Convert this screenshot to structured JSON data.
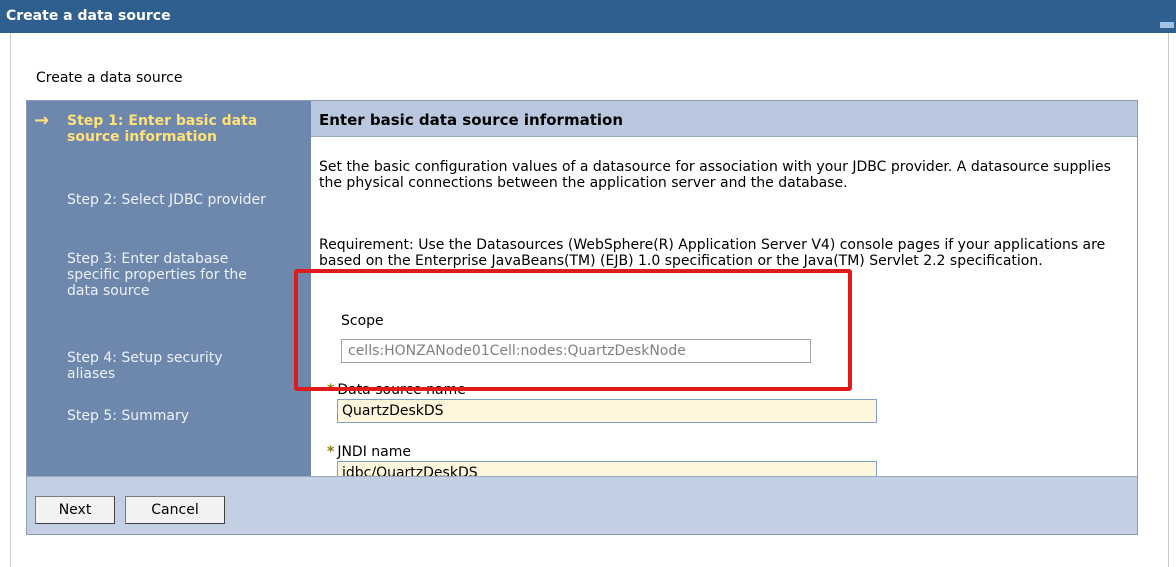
{
  "window": {
    "title": "Create a data source"
  },
  "page": {
    "heading": "Create a data source"
  },
  "steps": [
    {
      "label": "Step 1: Enter basic data source information",
      "active": true
    },
    {
      "label": "Step 2: Select JDBC provider",
      "active": false
    },
    {
      "label": "Step 3: Enter database specific properties for the data source",
      "active": false
    },
    {
      "label": "Step 4: Setup security aliases",
      "active": false
    },
    {
      "label": "Step 5: Summary",
      "active": false
    }
  ],
  "content": {
    "header": "Enter basic data source information",
    "description": "Set the basic configuration values of a datasource for association with your JDBC provider. A datasource supplies the physical connections between the application server and the database.",
    "requirement": "Requirement: Use the Datasources (WebSphere(R) Application Server V4) console pages if your applications are based on the Enterprise JavaBeans(TM) (EJB) 1.0 specification or the Java(TM) Servlet 2.2 specification.",
    "scope_label": "Scope",
    "scope_value": "cells:HONZANode01Cell:nodes:QuartzDeskNode",
    "datasource_name_label": "Data source name",
    "datasource_name_value": "QuartzDeskDS",
    "jndi_name_label": "JNDI name",
    "jndi_name_value": "jdbc/QuartzDeskDS",
    "required_marker": "*"
  },
  "buttons": {
    "next": "Next",
    "cancel": "Cancel"
  },
  "colors": {
    "titlebar": "#2f5f8f",
    "steps_panel": "#6d87ad",
    "active_step": "#ffe17a",
    "content_header": "#b9c8de",
    "highlight": "#e01b1b",
    "input_background": "#fdf5dc"
  },
  "icons": {
    "current_step": "arrow-right-icon"
  }
}
